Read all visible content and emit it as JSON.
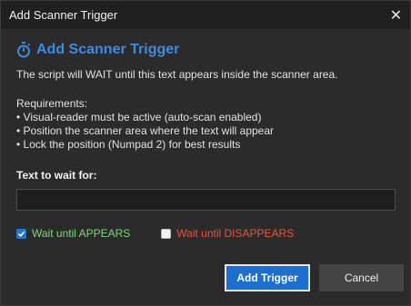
{
  "window": {
    "title": "Add Scanner Trigger",
    "close_glyph": "✕"
  },
  "heading": {
    "icon": "stopwatch-icon",
    "title": "Add Scanner Trigger",
    "accent": "#3d8be0"
  },
  "description": "The script will WAIT until this text appears inside the scanner area.",
  "requirements": {
    "title": "Requirements:",
    "items": [
      "• Visual-reader must be active (auto-scan enabled)",
      "• Position the scanner area where the text will appear",
      "• Lock the position (Numpad 2) for best results"
    ]
  },
  "field": {
    "label": "Text to wait for:",
    "value": "",
    "placeholder": ""
  },
  "options": {
    "appears": {
      "label": "Wait until APPEARS",
      "checked": true,
      "color": "#7fd67f"
    },
    "disappears": {
      "label": "Wait until DISAPPEARS",
      "checked": false,
      "color": "#e8543c"
    }
  },
  "buttons": {
    "add": "Add Trigger",
    "cancel": "Cancel"
  }
}
